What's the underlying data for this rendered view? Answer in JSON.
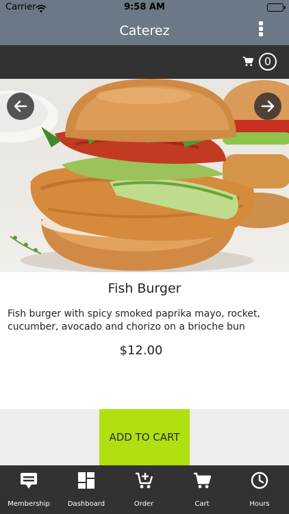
{
  "status_bar": {
    "carrier": "Carrier",
    "time": "9:58 AM"
  },
  "nav": {
    "title": "Caterez"
  },
  "toolbar": {
    "cart_count": "0"
  },
  "product": {
    "name": "Fish Burger",
    "description": "Fish burger with spicy smoked paprika mayo, rocket, cucumber, avocado and chorizo on a brioche bun",
    "price": "$12.00",
    "add_to_cart_label": "ADD TO CART"
  },
  "tabs": [
    {
      "label": "Membership",
      "icon": "membership-icon"
    },
    {
      "label": "Dashboard",
      "icon": "dashboard-icon"
    },
    {
      "label": "Order",
      "icon": "add-to-cart-icon"
    },
    {
      "label": "Cart",
      "icon": "cart-icon"
    },
    {
      "label": "Hours",
      "icon": "clock-icon"
    }
  ],
  "colors": {
    "header": "#6a7985",
    "toolbar": "#323232",
    "accent": "#b0e011",
    "cart_area": "#ededed"
  }
}
